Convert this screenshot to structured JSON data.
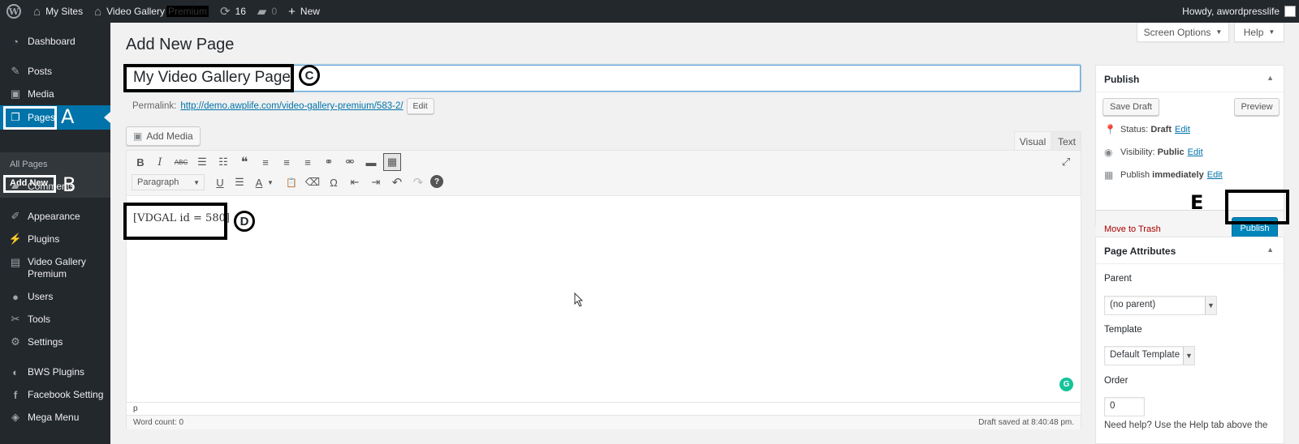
{
  "adminbar": {
    "wp_logo": "W",
    "my_sites": "My Sites",
    "site_name": "Video Gallery",
    "site_name_hidden": "Premium",
    "updates_count": "16",
    "comments_count": "0",
    "new_label": "New",
    "howdy": "Howdy, awordpresslife",
    "icons": {
      "my_sites": "network-icon",
      "site": "home-icon",
      "updates": "refresh-icon",
      "comments": "comment-icon",
      "new": "plus-icon"
    }
  },
  "sidebar": {
    "items": [
      {
        "label": "Dashboard",
        "icon": "dashboard-icon"
      },
      {
        "label": "Posts",
        "icon": "pin-icon"
      },
      {
        "label": "Media",
        "icon": "media-icon"
      },
      {
        "label": "Pages",
        "icon": "page-icon"
      },
      {
        "label": "Comments",
        "icon": "comment-icon"
      },
      {
        "label": "Appearance",
        "icon": "paintbrush-icon"
      },
      {
        "label": "Plugins",
        "icon": "plug-icon"
      },
      {
        "label": "Video Gallery",
        "label2": "Premium",
        "icon": "gallery-icon"
      },
      {
        "label": "Users",
        "icon": "user-icon"
      },
      {
        "label": "Tools",
        "icon": "wrench-icon"
      },
      {
        "label": "Settings",
        "icon": "settings-icon"
      },
      {
        "label": "BWS Plugins",
        "icon": "bws-icon"
      },
      {
        "label": "Facebook Setting",
        "icon": "facebook-icon"
      },
      {
        "label": "Mega Menu",
        "icon": "layers-icon"
      }
    ],
    "submenu": {
      "all_pages": "All Pages",
      "add_new": "Add New"
    }
  },
  "annotations": {
    "a": "A",
    "b": "B",
    "c": "C",
    "d": "D",
    "e": "E"
  },
  "main": {
    "page_title": "Add New Page",
    "screen_options": "Screen Options",
    "help": "Help",
    "title_value": "My Video Gallery Page",
    "permalink_label": "Permalink:",
    "permalink_url": "http://demo.awplife.com/video-gallery-premium/583-2/",
    "permalink_edit": "Edit",
    "add_media": "Add Media",
    "tab_visual": "Visual",
    "tab_text": "Text",
    "format_select": "Paragraph",
    "toolbar_glyphs": {
      "bold": "B",
      "italic": "I",
      "strike": "ABC",
      "ul": "☰",
      "ol": "☷",
      "quote": "❝",
      "align_left": "≡",
      "align_center": "≡",
      "align_right": "≡",
      "link": "⚭",
      "unlink": "⚮",
      "more": "▬",
      "kitchen": "▦",
      "fullscreen": "⤢",
      "underline": "U",
      "justify": "☰",
      "text_color": "A",
      "paste": "📋",
      "clear": "⌫",
      "omega": "Ω",
      "outdent": "⇤",
      "indent": "⇥",
      "undo": "↶",
      "redo": "↷",
      "help": "?"
    },
    "content": "[VDGAL id = 580]",
    "grammarly": "G",
    "path": "p",
    "word_count": "Word count: 0",
    "draft_saved": "Draft saved at 8:40:48 pm."
  },
  "publish_box": {
    "title": "Publish",
    "save_draft": "Save Draft",
    "preview": "Preview",
    "status_label": "Status:",
    "status_value": "Draft",
    "status_edit": "Edit",
    "visibility_label": "Visibility:",
    "visibility_value": "Public",
    "visibility_edit": "Edit",
    "publish_label": "Publish",
    "publish_value": "immediately",
    "publish_edit": "Edit",
    "move_to_trash": "Move to Trash",
    "publish_button": "Publish"
  },
  "page_attributes": {
    "title": "Page Attributes",
    "parent_label": "Parent",
    "parent_value": "(no parent)",
    "template_label": "Template",
    "template_value": "Default Template",
    "order_label": "Order",
    "order_value": "0",
    "help_text": "Need help? Use the Help tab above the"
  },
  "colors": {
    "adminbar": "#23282d",
    "current_menu": "#0073aa",
    "publish": "#0085ba",
    "link": "#0073aa",
    "trash": "#a00000"
  }
}
